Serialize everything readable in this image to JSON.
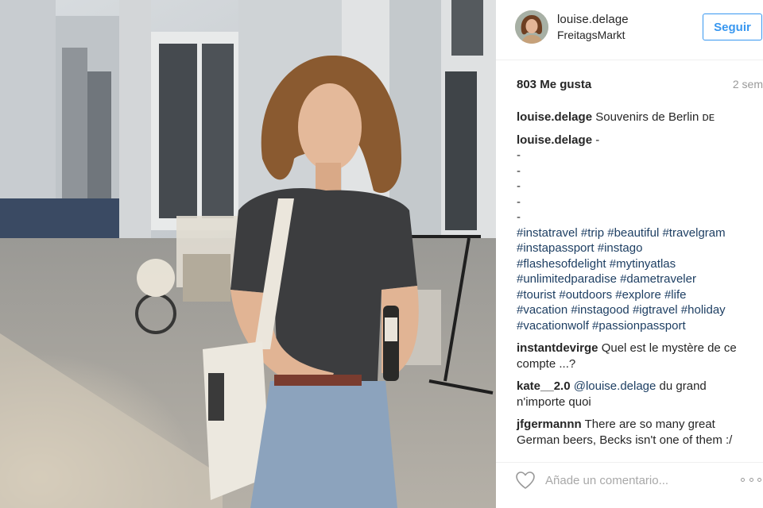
{
  "post": {
    "user": "louise.delage",
    "location": "FreitagsMarkt",
    "follow_label": "Seguir",
    "likes": "803 Me gusta",
    "time": "2 sem"
  },
  "comments": [
    {
      "author": "louise.delage",
      "text": "Souvenirs de Berlin ᴅᴇ"
    },
    {
      "author": "louise.delage",
      "text": "-"
    }
  ],
  "caption_dashes": [
    "-",
    "-",
    "-",
    "-",
    "-"
  ],
  "hashtags": [
    "#instatravel #trip #beautiful #travelgram",
    "#instapassport #instago",
    "#flashesofdelight #mytinyatlas",
    "#unlimitedparadise #dametraveler",
    "#tourist #outdoors #explore #life",
    "#vacation #instagood #igtravel #holiday",
    "#vacationwolf #passionpassport"
  ],
  "more_comments": [
    {
      "author": "instantdevirge",
      "text": "Quel est le mystère de ce compte ...?"
    },
    {
      "author": "kate__2.0",
      "mention": "@louise.delage",
      "text": "du grand n'importe quoi"
    },
    {
      "author": "jfgermannn",
      "text": "There are so many great German beers, Becks isn't one of them :/"
    }
  ],
  "footer": {
    "comment_placeholder": "Añade un comentario..."
  },
  "icons": {
    "like": "heart-icon",
    "options": "more-options-icon"
  },
  "colors": {
    "follow_blue": "#3897f0",
    "hashtag": "#1e3f63",
    "muted": "#999999"
  }
}
